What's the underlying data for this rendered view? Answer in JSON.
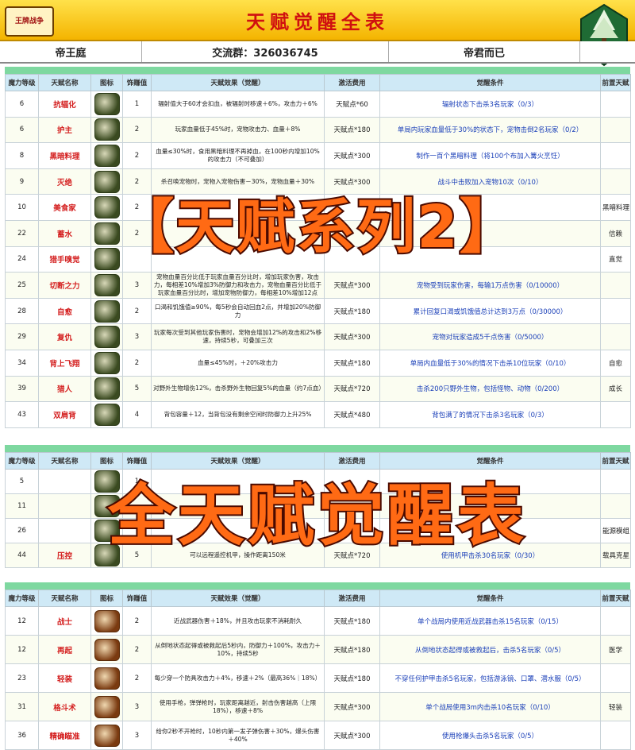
{
  "header": {
    "logo_text": "王牌战争",
    "title": "天赋觉醒全表",
    "left": "帝王庭",
    "group": "交流群：326036745",
    "right": "帝君而已"
  },
  "columns": [
    "魔力等级",
    "天赋名称",
    "图标",
    "饰赚值",
    "天赋效果（觉醒）",
    "激活费用",
    "觉醒条件",
    "前置天赋"
  ],
  "section1": [
    {
      "level": "6",
      "name": "抗辐化",
      "value": "1",
      "effect": "辐射值大于60才会扣血，被辐射时移速＋6%，攻击力＋6%",
      "cost": "天赋点*60",
      "cond": "辐射状态下击杀3名玩家（0/3）",
      "pre": ""
    },
    {
      "level": "6",
      "name": "护主",
      "value": "2",
      "effect": "玩家血量低于45%时，宠物攻击力、血量＋8%",
      "cost": "天赋点*180",
      "cond": "单局内玩家血量低于30%的状态下，宠物击倒2名玩家（0/2）",
      "pre": ""
    },
    {
      "level": "8",
      "name": "黑暗料理",
      "value": "2",
      "effect": "血量≤30%时，食用黑暗料理不再掉血，在100秒内增加10%的攻击力（不可叠加）",
      "cost": "天赋点*300",
      "cond": "制作一百个黑暗料理（将100个布加入篝火烹饪）",
      "pre": ""
    },
    {
      "level": "9",
      "name": "灭绝",
      "value": "2",
      "effect": "杀召唤宠物时，宠物入宠物伤害－30%，宠物血量＋30%",
      "cost": "天赋点*300",
      "cond": "战斗中击败加入宠物10次（0/10）",
      "pre": ""
    },
    {
      "level": "10",
      "name": "美食家",
      "value": "2",
      "effect": "",
      "cost": "",
      "cond": "",
      "pre": "黑暗料理"
    },
    {
      "level": "22",
      "name": "蓄水",
      "value": "2",
      "effect": "",
      "cost": "",
      "cond": "",
      "pre": "信赖"
    },
    {
      "level": "24",
      "name": "猎手嗅觉",
      "value": "",
      "effect": "",
      "cost": "",
      "cond": "",
      "pre": "直觉"
    },
    {
      "level": "25",
      "name": "切断之力",
      "value": "3",
      "effect": "宠物血量百分比低于玩家血量百分比时，增加玩家伤害，攻击力，每相差10%增加3%防御力和攻击力，宠物血量百分比低于玩家血量百分比时，增加宠物防御力，每相差10%增加12点",
      "cost": "天赋点*300",
      "cond": "宠物受到玩家伤害，每输1万点伤害（0/10000）",
      "pre": ""
    },
    {
      "level": "28",
      "name": "自愈",
      "value": "2",
      "effect": "口渴和饥饿值≥90%，每5秒会自动回血2点，并增加20%防御力",
      "cost": "天赋点*180",
      "cond": "累计回复口渴或饥饿值总计达到3万点（0/30000）",
      "pre": ""
    },
    {
      "level": "29",
      "name": "复仇",
      "value": "3",
      "effect": "玩家每次受到其他玩家伤害时，宠物会增加12%的攻击和2%移速，持续5秒，可叠加三次",
      "cost": "天赋点*300",
      "cond": "宠物对玩家造成5千点伤害（0/5000）",
      "pre": ""
    },
    {
      "level": "34",
      "name": "背上飞翔",
      "value": "2",
      "effect": "血量≤45%时，＋20%攻击力",
      "cost": "天赋点*180",
      "cond": "单局内血量低于30%的情况下击杀10位玩家（0/10）",
      "pre": "自愈"
    },
    {
      "level": "39",
      "name": "猎人",
      "value": "5",
      "effect": "对野外生物增伤12%，击杀野外生物回复5%的血量（约7点血）",
      "cost": "天赋点*720",
      "cond": "击杀200只野外生物，包括怪物、动物（0/200）",
      "pre": "成长"
    },
    {
      "level": "43",
      "name": "双肩背",
      "value": "4",
      "effect": "背包容量＋12，当背包没有剩余空间时防御力上升25%",
      "cost": "天赋点*480",
      "cond": "背包满了的情况下击杀3名玩家（0/3）",
      "pre": ""
    }
  ],
  "section2": [
    {
      "level": "5",
      "name": "",
      "value": "1",
      "effect": "",
      "cost": "",
      "cond": "",
      "pre": ""
    },
    {
      "level": "11",
      "name": "",
      "value": "",
      "effect": "",
      "cost": "",
      "cond": "",
      "pre": ""
    },
    {
      "level": "26",
      "name": "",
      "value": "",
      "effect": "",
      "cost": "",
      "cond": "",
      "pre": "能源模组"
    },
    {
      "level": "44",
      "name": "压控",
      "value": "5",
      "effect": "可以远程遥控机甲，操作距离150米",
      "cost": "天赋点*720",
      "cond": "使用机甲击杀30名玩家（0/30）",
      "pre": "载具克星"
    }
  ],
  "section3": [
    {
      "level": "12",
      "name": "战士",
      "value": "2",
      "effect": "近战武器伤害＋18%，并且攻击玩家不消耗耐久",
      "cost": "天赋点*180",
      "cond": "单个战局内使用近战武器击杀15名玩家（0/15）",
      "pre": ""
    },
    {
      "level": "12",
      "name": "再起",
      "value": "2",
      "effect": "从倒地状态起得或被救起后5秒内，防御力＋100%，攻击力＋10%，持续5秒",
      "cost": "天赋点*180",
      "cond": "从倒地状态起得或被救起后，击杀5名玩家（0/5）",
      "pre": "医学"
    },
    {
      "level": "23",
      "name": "轻装",
      "value": "2",
      "effect": "每少穿一个防具攻击力＋4%，移速＋2%（最高36%｜18%）",
      "cost": "天赋点*180",
      "cond": "不穿任何护甲击杀5名玩家，包括游泳镜、口罩、潜水服（0/5）",
      "pre": ""
    },
    {
      "level": "31",
      "name": "格斗术",
      "value": "3",
      "effect": "使用手枪，弹弹枪时，玩家距离越近，射击伤害越高（上限18%），移速＋8%",
      "cost": "天赋点*300",
      "cond": "单个战局使用3m内击杀10名玩家（0/10）",
      "pre": "轻装"
    },
    {
      "level": "36",
      "name": "精确瞄准",
      "value": "3",
      "effect": "给你2秒不开枪时，10秒内第一发子弹伤害＋30%，爆头伤害＋40%",
      "cost": "天赋点*300",
      "cond": "使用枪爆头击杀5名玩家（0/5）",
      "pre": ""
    }
  ],
  "overlay": {
    "line1": "【天赋系列2】",
    "line2": "全天赋觉醒表"
  }
}
